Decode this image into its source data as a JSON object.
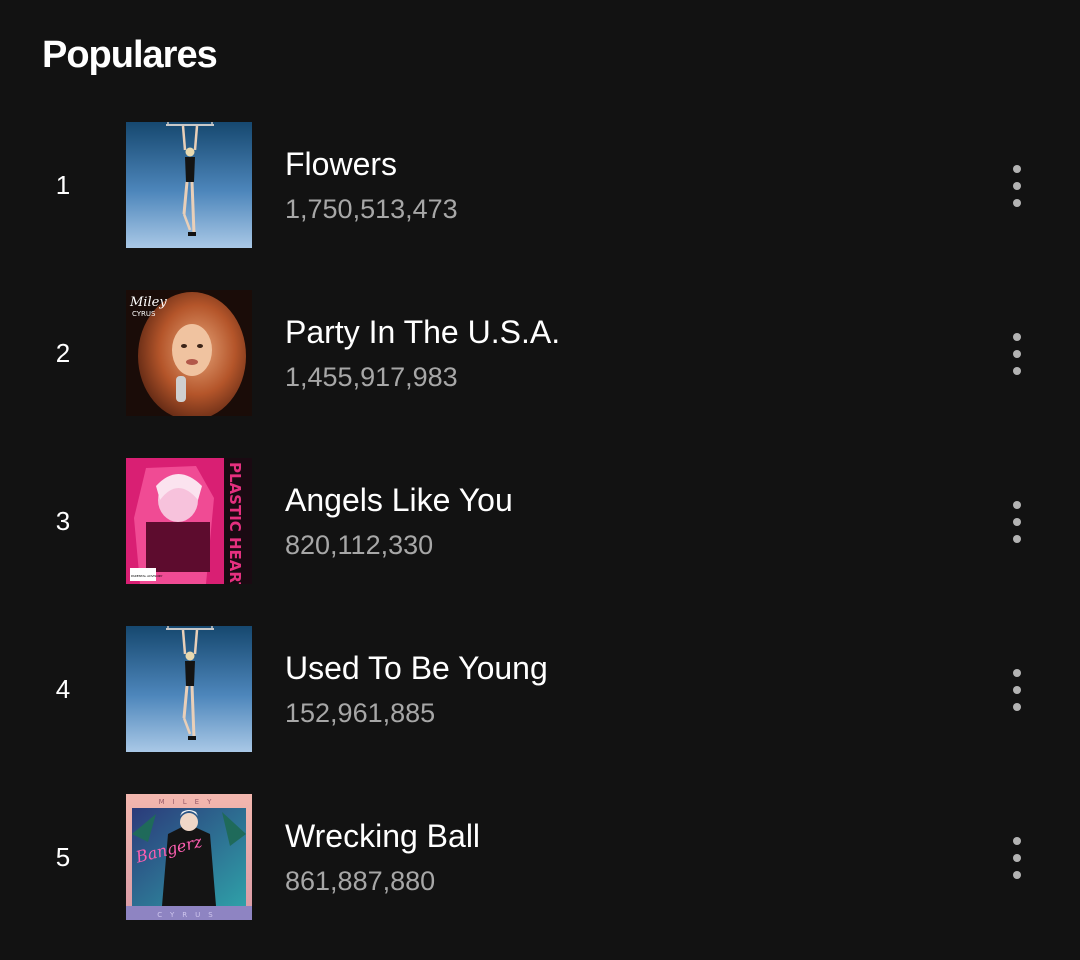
{
  "header": {
    "title": "Populares"
  },
  "tracks": [
    {
      "rank": "1",
      "title": "Flowers",
      "plays": "1,750,513,473",
      "cover": "endless-summer-vacation-cover",
      "colors": {
        "top": "#1f4f79",
        "bottom": "#9fc1e3"
      }
    },
    {
      "rank": "2",
      "title": "Party In The U.S.A.",
      "plays": "1,455,917,983",
      "cover": "the-time-of-our-lives-cover",
      "cover_text": {
        "artist": "Miley",
        "sub": "CYRUS"
      },
      "colors": {
        "top": "#3a1a10",
        "bottom": "#d98250"
      }
    },
    {
      "rank": "3",
      "title": "Angels Like You",
      "plays": "820,112,330",
      "cover": "plastic-hearts-cover",
      "cover_text": {
        "side": "PLASTIC HEARTS",
        "advisory": "PARENTAL ADVISORY"
      },
      "colors": {
        "top": "#e3267d",
        "bottom": "#1a0a10"
      }
    },
    {
      "rank": "4",
      "title": "Used To Be Young",
      "plays": "152,961,885",
      "cover": "endless-summer-vacation-cover",
      "colors": {
        "top": "#1f4f79",
        "bottom": "#9fc1e3"
      }
    },
    {
      "rank": "5",
      "title": "Wrecking Ball",
      "plays": "861,887,880",
      "cover": "bangerz-cover",
      "cover_text": {
        "top": "MILEY",
        "script": "Bangerz",
        "bottom": "CYRUS"
      },
      "colors": {
        "top": "#f2b8ad",
        "bottom": "#7a6fae"
      }
    }
  ],
  "icons": {
    "more": "more-options-vertical-icon"
  }
}
